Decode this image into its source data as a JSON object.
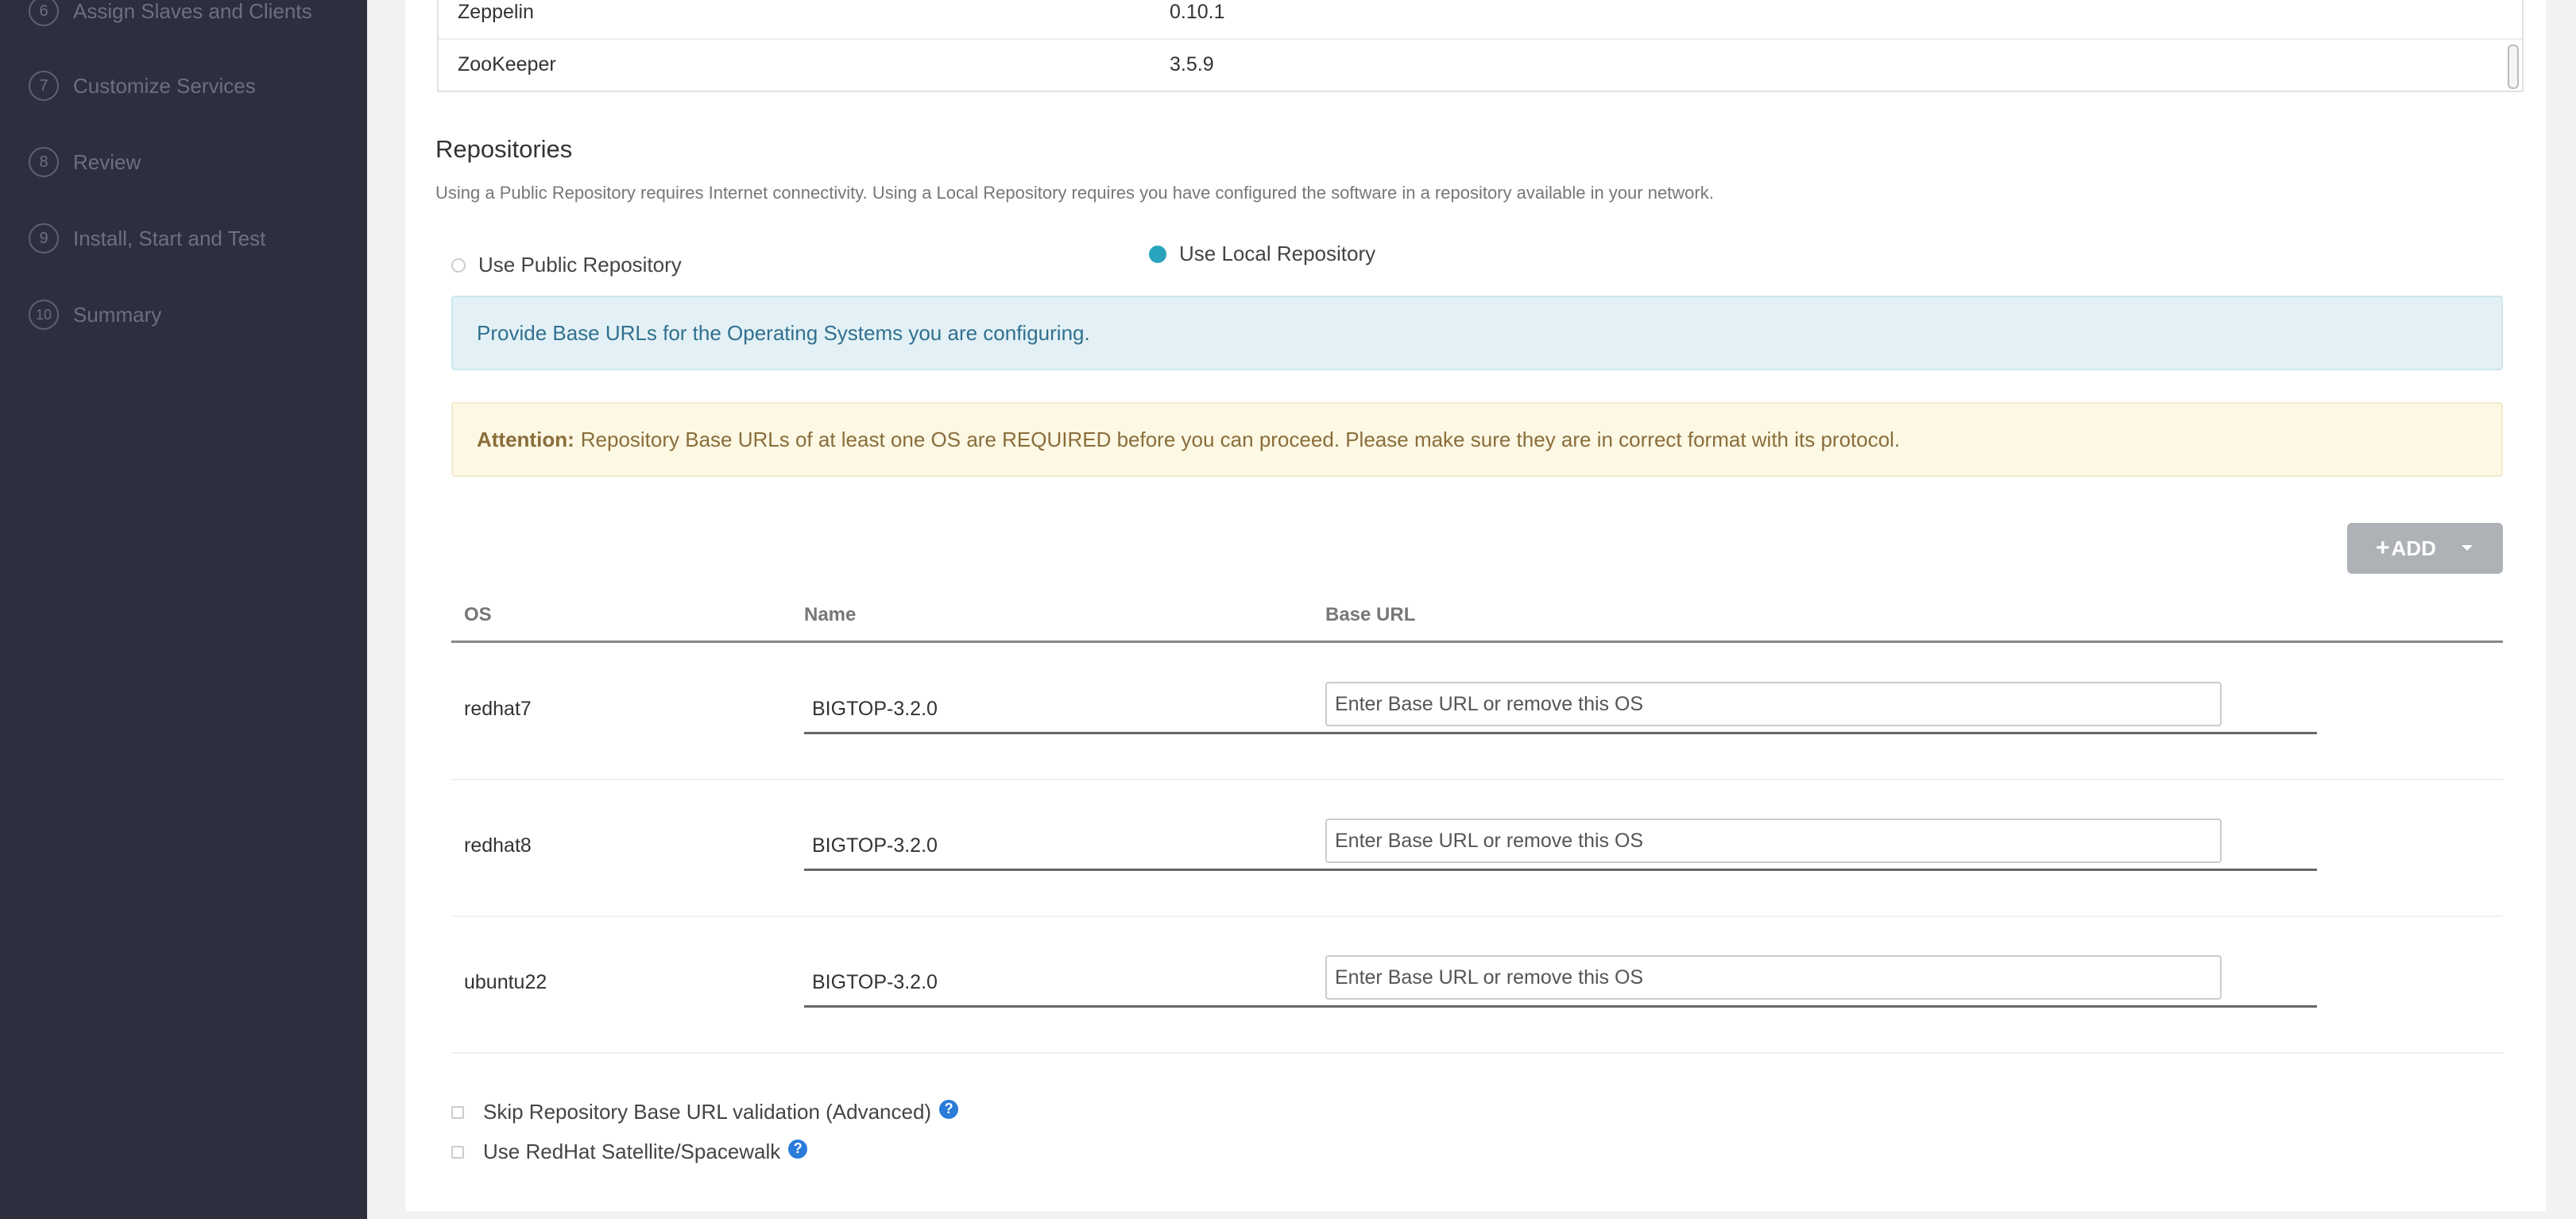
{
  "sidebar": {
    "steps": [
      {
        "num": "6",
        "label": "Assign Slaves and Clients"
      },
      {
        "num": "7",
        "label": "Customize Services"
      },
      {
        "num": "8",
        "label": "Review"
      },
      {
        "num": "9",
        "label": "Install, Start and Test"
      },
      {
        "num": "10",
        "label": "Summary"
      }
    ]
  },
  "stack_table": {
    "rows": [
      {
        "service": "Zeppelin",
        "version": "0.10.1"
      },
      {
        "service": "ZooKeeper",
        "version": "3.5.9"
      }
    ]
  },
  "repositories": {
    "title": "Repositories",
    "description": "Using a Public Repository requires Internet connectivity. Using a Local Repository requires you have configured the software in a repository available in your network.",
    "public_label": "Use Public Repository",
    "local_label": "Use Local Repository",
    "selected": "local",
    "info_alert": "Provide Base URLs for the Operating Systems you are configuring.",
    "warning_strong": "Attention:",
    "warning_text": "Repository Base URLs of at least one OS are REQUIRED before you can proceed. Please make sure they are in correct format with its protocol.",
    "add_button": "ADD",
    "columns": {
      "os": "OS",
      "name": "Name",
      "base_url": "Base URL"
    },
    "rows": [
      {
        "os": "redhat7",
        "name": "BIGTOP-3.2.0",
        "url_value": "",
        "url_placeholder": "Enter Base URL or remove this OS"
      },
      {
        "os": "redhat8",
        "name": "BIGTOP-3.2.0",
        "url_value": "",
        "url_placeholder": "Enter Base URL or remove this OS"
      },
      {
        "os": "ubuntu22",
        "name": "BIGTOP-3.2.0",
        "url_value": "",
        "url_placeholder": "Enter Base URL or remove this OS"
      }
    ],
    "skip_validation_label": "Skip Repository Base URL validation (Advanced)",
    "satellite_label": "Use RedHat Satellite/Spacewalk"
  },
  "colors": {
    "sidebar_bg": "#2d2f3f",
    "accent": "#2aa4bd",
    "help_icon": "#2b7bd9"
  }
}
